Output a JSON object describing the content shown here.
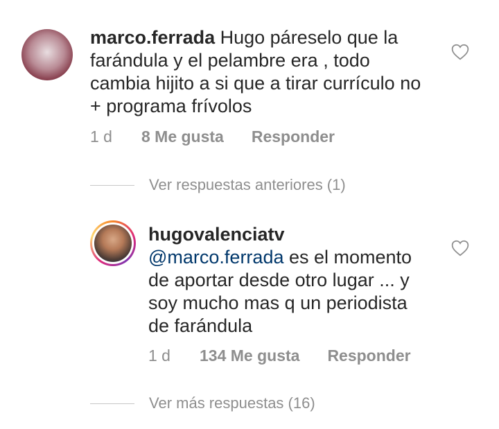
{
  "comment": {
    "username": "marco.ferrada",
    "text_line1": "Hugo páreselo que la",
    "text_line2": "farándula y el pelambre era , todo",
    "text_line3": "cambia hijito a si que a tirar currículo no",
    "text_line4": "+ programa frívolos",
    "time": "1 d",
    "likes": "8 Me gusta",
    "reply_label": "Responder"
  },
  "view_previous": {
    "label": "Ver respuestas anteriores (1)"
  },
  "reply": {
    "username": "hugovalenciatv",
    "mention": "@marco.ferrada",
    "text_line1": " es el momento",
    "text_line2": "de aportar desde otro lugar ... y",
    "text_line3": "soy mucho mas q un periodista",
    "text_line4": "de farándula",
    "time": "1 d",
    "likes": "134 Me gusta",
    "reply_label": "Responder"
  },
  "view_more": {
    "label": "Ver más respuestas (16)"
  },
  "icons": {
    "like": "heart-outline-icon"
  }
}
